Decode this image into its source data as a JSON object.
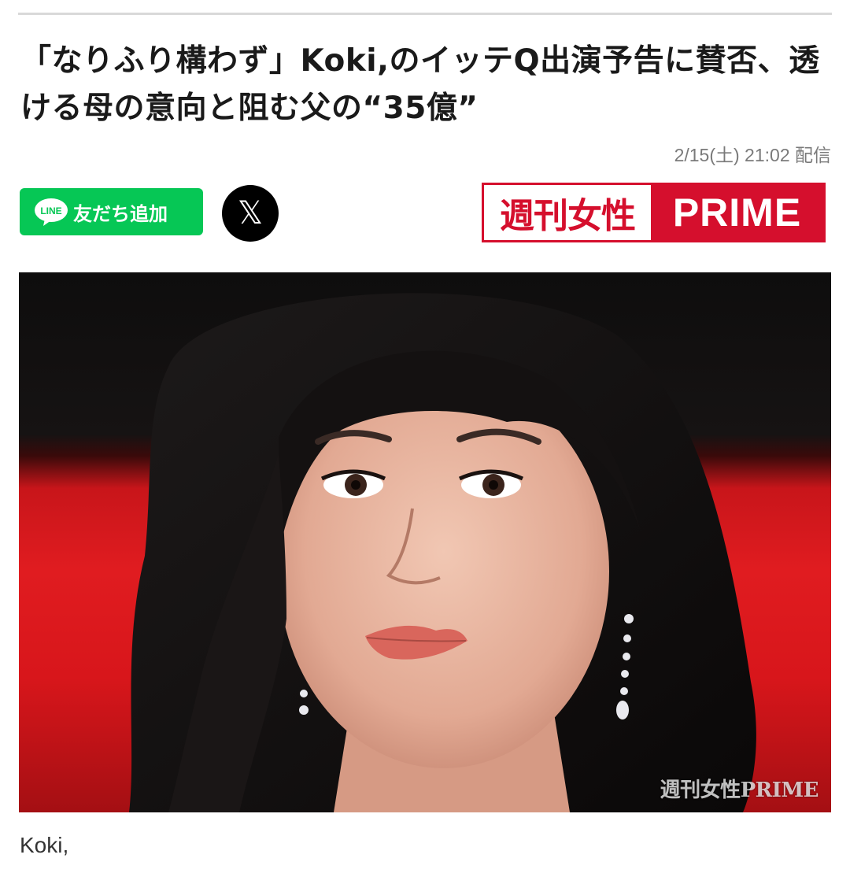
{
  "article": {
    "headline": "「なりふり構わず」Koki,のイッテQ出演予告に賛否、透ける母の意向と阻む父の“35億”",
    "date": "2/15(土) 21:02 配信",
    "caption": "Koki,"
  },
  "share": {
    "line_logo_text": "LINE",
    "line_label": "友だち追加",
    "x_icon_glyph": "𝕏"
  },
  "brand": {
    "jp": "週刊女性",
    "en": "PRIME"
  },
  "photo": {
    "watermark": "週刊女性PRIME"
  },
  "colors": {
    "line_green": "#06c755",
    "brand_red": "#d50f2d"
  }
}
